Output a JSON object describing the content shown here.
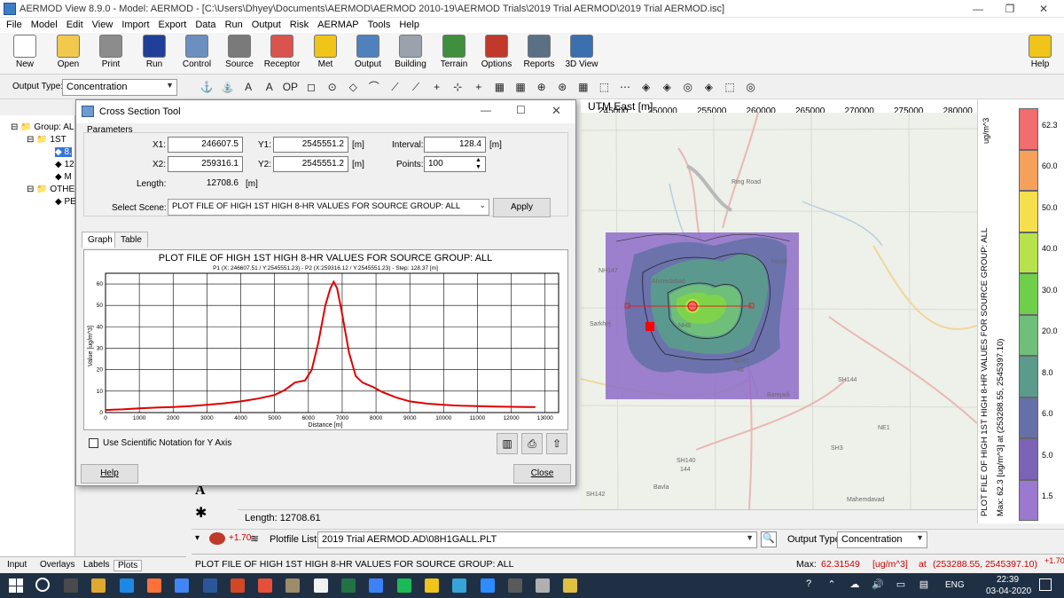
{
  "window": {
    "title": "AERMOD View 8.9.0 - Model: AERMOD - [C:\\Users\\Dhyey\\Documents\\AERMOD\\AERMOD 2010-19\\AERMOD Trials\\2019 Trial AERMOD\\2019 Trial AERMOD.isc]"
  },
  "menu": [
    "File",
    "Model",
    "Edit",
    "View",
    "Import",
    "Export",
    "Data",
    "Run",
    "Output",
    "Risk",
    "AERMAP",
    "Tools",
    "Help"
  ],
  "toolbar": [
    {
      "label": "New",
      "icon": "new-file-icon",
      "color": "#ffffff"
    },
    {
      "label": "Open",
      "icon": "open-folder-icon",
      "color": "#f2c94c"
    },
    {
      "label": "Print",
      "icon": "printer-icon",
      "color": "#8c8c8c"
    },
    {
      "label": "Run",
      "icon": "run-arrow-icon",
      "color": "#1f3f99"
    },
    {
      "label": "Control",
      "icon": "control-icon",
      "color": "#6b8fbf"
    },
    {
      "label": "Source",
      "icon": "source-stack-icon",
      "color": "#7a7a7a"
    },
    {
      "label": "Receptor",
      "icon": "receptor-icon",
      "color": "#d9534f"
    },
    {
      "label": "Met",
      "icon": "weather-icon",
      "color": "#f0c419"
    },
    {
      "label": "Output",
      "icon": "output-icon",
      "color": "#4f81bd"
    },
    {
      "label": "Building",
      "icon": "building-icon",
      "color": "#9aa3ad"
    },
    {
      "label": "Terrain",
      "icon": "terrain-icon",
      "color": "#3f8f3f"
    },
    {
      "label": "Options",
      "icon": "options-grid-icon",
      "color": "#c0392b"
    },
    {
      "label": "Reports",
      "icon": "reports-icon",
      "color": "#5b6f85"
    },
    {
      "label": "3D View",
      "icon": "3d-view-icon",
      "color": "#3a6fb0"
    },
    {
      "label": "Help",
      "icon": "help-icon",
      "color": "#f0c419"
    }
  ],
  "output_type": {
    "label": "Output Type:",
    "value": "Concentration"
  },
  "tree": {
    "group": "Group: AL",
    "first": "1ST",
    "items": [
      "8.",
      "12",
      "M"
    ],
    "other": "OTHE",
    "other_item": "PE"
  },
  "bottom_tabs": [
    "Input",
    "Overlays",
    "Labels",
    "Plots"
  ],
  "dialog": {
    "title": "Cross Section Tool",
    "params_label": "Parameters",
    "x1_label": "X1:",
    "x1": "246607.5",
    "y1_label": "Y1:",
    "y1": "2545551.2",
    "unit_m": "[m]",
    "x2_label": "X2:",
    "x2": "259316.1",
    "y2_label": "Y2:",
    "y2": "2545551.2",
    "interval_label": "Interval:",
    "interval": "128.4",
    "points_label": "Points:",
    "points": "100",
    "length_label": "Length:",
    "length": "12708.6",
    "scene_label": "Select Scene:",
    "scene": "PLOT FILE OF HIGH 1ST HIGH 8-HR VALUES FOR SOURCE GROUP: ALL",
    "apply": "Apply",
    "tab_graph": "Graph",
    "tab_table": "Table",
    "sci_label": "Use Scientific Notation for Y Axis",
    "help": "Help",
    "close": "Close"
  },
  "map": {
    "axis_title": "UTM East [m]",
    "ticks": [
      "245000",
      "250000",
      "255000",
      "260000",
      "265000",
      "270000",
      "275000",
      "280000"
    ],
    "labels": [
      "Ring Road",
      "NH147",
      "NH48",
      "Sarkhej",
      "NH8",
      "NH47",
      "48",
      "SH144",
      "NE1",
      "Barejadi",
      "SH3",
      "SH140",
      "144",
      "SH142",
      "Bavla",
      "Mahemdavad",
      "Ahmedabad"
    ]
  },
  "legend": {
    "unit": "ug/m^3",
    "title": "PLOT FILE OF HIGH 1ST HIGH 8-HR VALUES FOR SOURCE GROUP: ALL",
    "max": "Max:  62.3  [ug/m^3]  at  (253288.55, 2545397.10)",
    "levels": [
      {
        "v": "62.3",
        "c": "#f26d6d"
      },
      {
        "v": "60.0",
        "c": "#f5a15c"
      },
      {
        "v": "50.0",
        "c": "#f5df4d"
      },
      {
        "v": "40.0",
        "c": "#b7e24b"
      },
      {
        "v": "30.0",
        "c": "#6fcf4a"
      },
      {
        "v": "20.0",
        "c": "#6fbf7a"
      },
      {
        "v": "8.0",
        "c": "#5b9b8c"
      },
      {
        "v": "6.0",
        "c": "#6670a8"
      },
      {
        "v": "5.0",
        "c": "#7c63b5"
      },
      {
        "v": "1.5",
        "c": "#9b79d0"
      }
    ]
  },
  "length_status": "Length: 12708.61",
  "plotfile": {
    "label": "Plotfile List:",
    "value": "2019 Trial AERMOD.AD\\08H1GALL.PLT",
    "output_label": "Output Type:",
    "output_value": "Concentration"
  },
  "status": {
    "left": "PLOT FILE OF HIGH 1ST HIGH 8-HR VALUES FOR SOURCE GROUP: ALL",
    "max_label": "Max:",
    "max_value": "62.31549",
    "max_unit": "[ug/m^3]",
    "max_at": "at",
    "max_coord": "(253288.55, 2545397.10)"
  },
  "taskbar": {
    "time": "22:39",
    "date": "03-04-2020",
    "lang": "ENG"
  },
  "chart_data": {
    "type": "line",
    "title": "PLOT FILE OF HIGH 1ST HIGH 8-HR VALUES FOR SOURCE GROUP: ALL",
    "subtitle": "P1 (X: 246607.51 / Y:2545551.23) - P2 (X:259316.12 / Y:2545551.23) - Step: 128.37 [m]",
    "xlabel": "Distance [m]",
    "ylabel": "Value [ug/m^3]",
    "xlim": [
      0,
      13400
    ],
    "ylim": [
      0,
      65
    ],
    "xticks": [
      0,
      1000,
      2000,
      3000,
      4000,
      5000,
      6000,
      7000,
      8000,
      9000,
      10000,
      11000,
      12000,
      13000
    ],
    "yticks": [
      0,
      10,
      20,
      30,
      40,
      50,
      60
    ],
    "series": [
      {
        "color": "#e00000",
        "x": [
          0,
          500,
          1000,
          1500,
          2000,
          2500,
          3000,
          3500,
          4000,
          4500,
          5000,
          5300,
          5600,
          5900,
          6100,
          6300,
          6500,
          6650,
          6750,
          6850,
          7000,
          7200,
          7400,
          7600,
          7900,
          8200,
          8600,
          9000,
          9500,
          10000,
          10500,
          11000,
          11500,
          12000,
          12500,
          12708
        ],
        "values": [
          1.2,
          1.5,
          2.0,
          2.3,
          2.6,
          3.0,
          3.6,
          4.3,
          5.2,
          6.5,
          8.2,
          10.5,
          14,
          15,
          20,
          33,
          50,
          58,
          61,
          58,
          46,
          28,
          17,
          14,
          12,
          9.5,
          7,
          5.2,
          4.2,
          3.6,
          3.2,
          3.0,
          2.8,
          2.7,
          2.6,
          2.6
        ]
      }
    ]
  }
}
